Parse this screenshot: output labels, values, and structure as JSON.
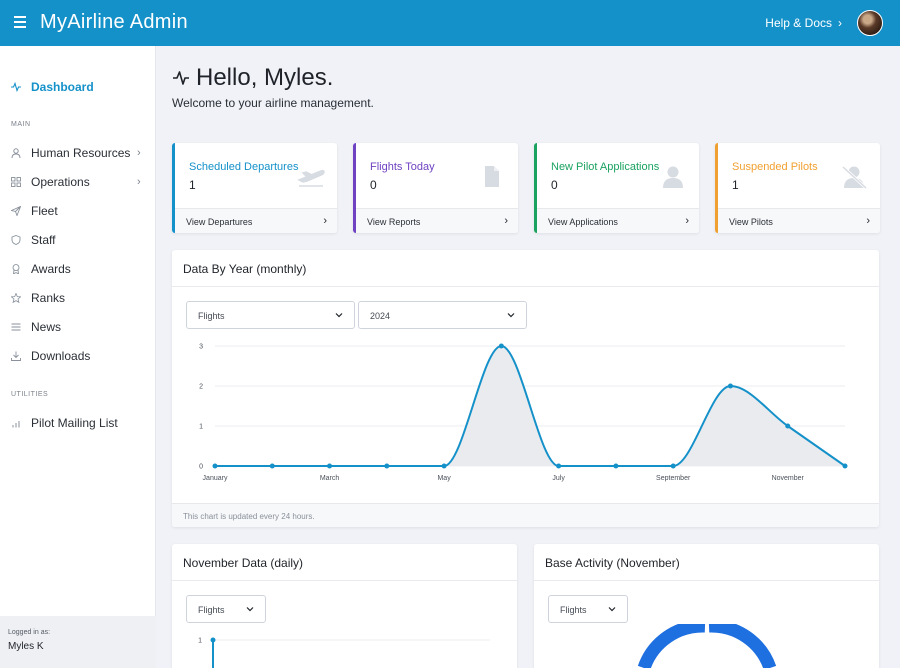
{
  "header": {
    "app_title": "MyAirline Admin",
    "help_label": "Help & Docs"
  },
  "sidebar": {
    "dashboard": "Dashboard",
    "section_main": "MAIN",
    "main_items": [
      {
        "label": "Human Resources",
        "icon": "user-icon",
        "has_submenu": true
      },
      {
        "label": "Operations",
        "icon": "grid-icon",
        "has_submenu": true
      },
      {
        "label": "Fleet",
        "icon": "paper-plane-icon"
      },
      {
        "label": "Staff",
        "icon": "shield-icon"
      },
      {
        "label": "Awards",
        "icon": "award-icon"
      },
      {
        "label": "Ranks",
        "icon": "star-icon"
      },
      {
        "label": "News",
        "icon": "list-icon"
      },
      {
        "label": "Downloads",
        "icon": "download-icon"
      }
    ],
    "section_utilities": "UTILITIES",
    "utility_items": [
      {
        "label": "Pilot Mailing List",
        "icon": "bar-chart-icon"
      }
    ],
    "logged_in_label": "Logged in as:",
    "logged_in_user": "Myles K"
  },
  "greeting": {
    "title": "Hello, Myles.",
    "subtitle": "Welcome to your airline management."
  },
  "stats": [
    {
      "title": "Scheduled Departures",
      "value": "1",
      "link": "View Departures",
      "color": "#1591c9",
      "icon": "airplane-departure-icon"
    },
    {
      "title": "Flights Today",
      "value": "0",
      "link": "View Reports",
      "color": "#6f42c1",
      "icon": "document-icon"
    },
    {
      "title": "New Pilot Applications",
      "value": "0",
      "link": "View Applications",
      "color": "#1aa260",
      "icon": "user-icon"
    },
    {
      "title": "Suspended Pilots",
      "value": "1",
      "link": "View Pilots",
      "color": "#f0a030",
      "icon": "user-slash-icon"
    }
  ],
  "yearly_chart": {
    "title": "Data By Year (monthly)",
    "metric_select": "Flights",
    "year_select": "2024",
    "note": "This chart is updated every 24 hours."
  },
  "november_daily": {
    "title": "November Data (daily)",
    "metric_select": "Flights"
  },
  "base_activity": {
    "title": "Base Activity (November)",
    "metric_select": "Flights"
  },
  "chart_data": [
    {
      "type": "area",
      "title": "Data By Year (monthly)",
      "x": [
        "January",
        "February",
        "March",
        "April",
        "May",
        "June",
        "July",
        "August",
        "September",
        "October",
        "November",
        "December"
      ],
      "x_tick_labels": [
        "January",
        "March",
        "May",
        "July",
        "September",
        "November"
      ],
      "series": [
        {
          "values": [
            0,
            0,
            0,
            0,
            0,
            3,
            0,
            0,
            0,
            2,
            1,
            0
          ]
        }
      ],
      "ylim": [
        0,
        3
      ],
      "y_ticks": [
        0,
        1,
        2,
        3
      ],
      "grid": true,
      "line_color": "#1591c9"
    },
    {
      "type": "line",
      "title": "November Data (daily)",
      "y_ticks_visible": [
        1
      ],
      "grid": true,
      "line_color": "#1591c9"
    },
    {
      "type": "pie",
      "title": "Base Activity (November)",
      "slice_color": "#1e6fe0"
    }
  ]
}
